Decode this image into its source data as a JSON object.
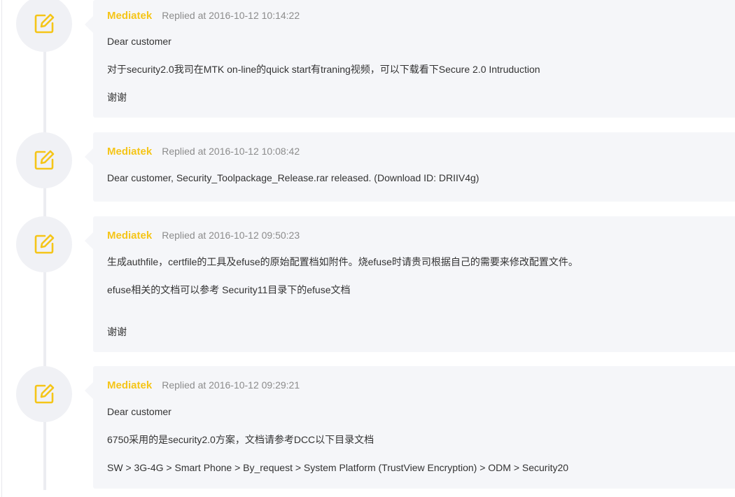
{
  "colors": {
    "author": "#f5c518",
    "timestamp": "#8c8c8c",
    "body_text": "#333333",
    "card_bg": "#f5f6f9",
    "avatar_bg": "#f0f1f5",
    "icon": "#f5c518"
  },
  "replies": [
    {
      "author": "Mediatek",
      "replied_at": "Replied at 2016-10-12 10:14:22",
      "icon": "edit-icon",
      "lines": [
        "Dear customer",
        "对于security2.0我司在MTK on-line的quick start有traning视频，可以下载看下Secure 2.0 Intruduction",
        "谢谢"
      ]
    },
    {
      "author": "Mediatek",
      "replied_at": "Replied at 2016-10-12 10:08:42",
      "icon": "edit-icon",
      "lines": [
        "Dear customer, Security_Toolpackage_Release.rar released. (Download ID: DRIIV4g)"
      ]
    },
    {
      "author": "Mediatek",
      "replied_at": "Replied at 2016-10-12 09:50:23",
      "icon": "edit-icon",
      "lines": [
        "生成authfile，certfile的工具及efuse的原始配置档如附件。烧efuse时请贵司根据自己的需要来修改配置文件。",
        "efuse相关的文档可以参考 Security11目录下的efuse文档",
        "谢谢"
      ]
    },
    {
      "author": "Mediatek",
      "replied_at": "Replied at 2016-10-12 09:29:21",
      "icon": "edit-icon",
      "lines": [
        "Dear customer",
        "6750采用的是security2.0方案，文档请参考DCC以下目录文档",
        "SW > 3G-4G > Smart Phone > By_request > System Platform (TrustView Encryption) > ODM > Security20"
      ]
    }
  ]
}
